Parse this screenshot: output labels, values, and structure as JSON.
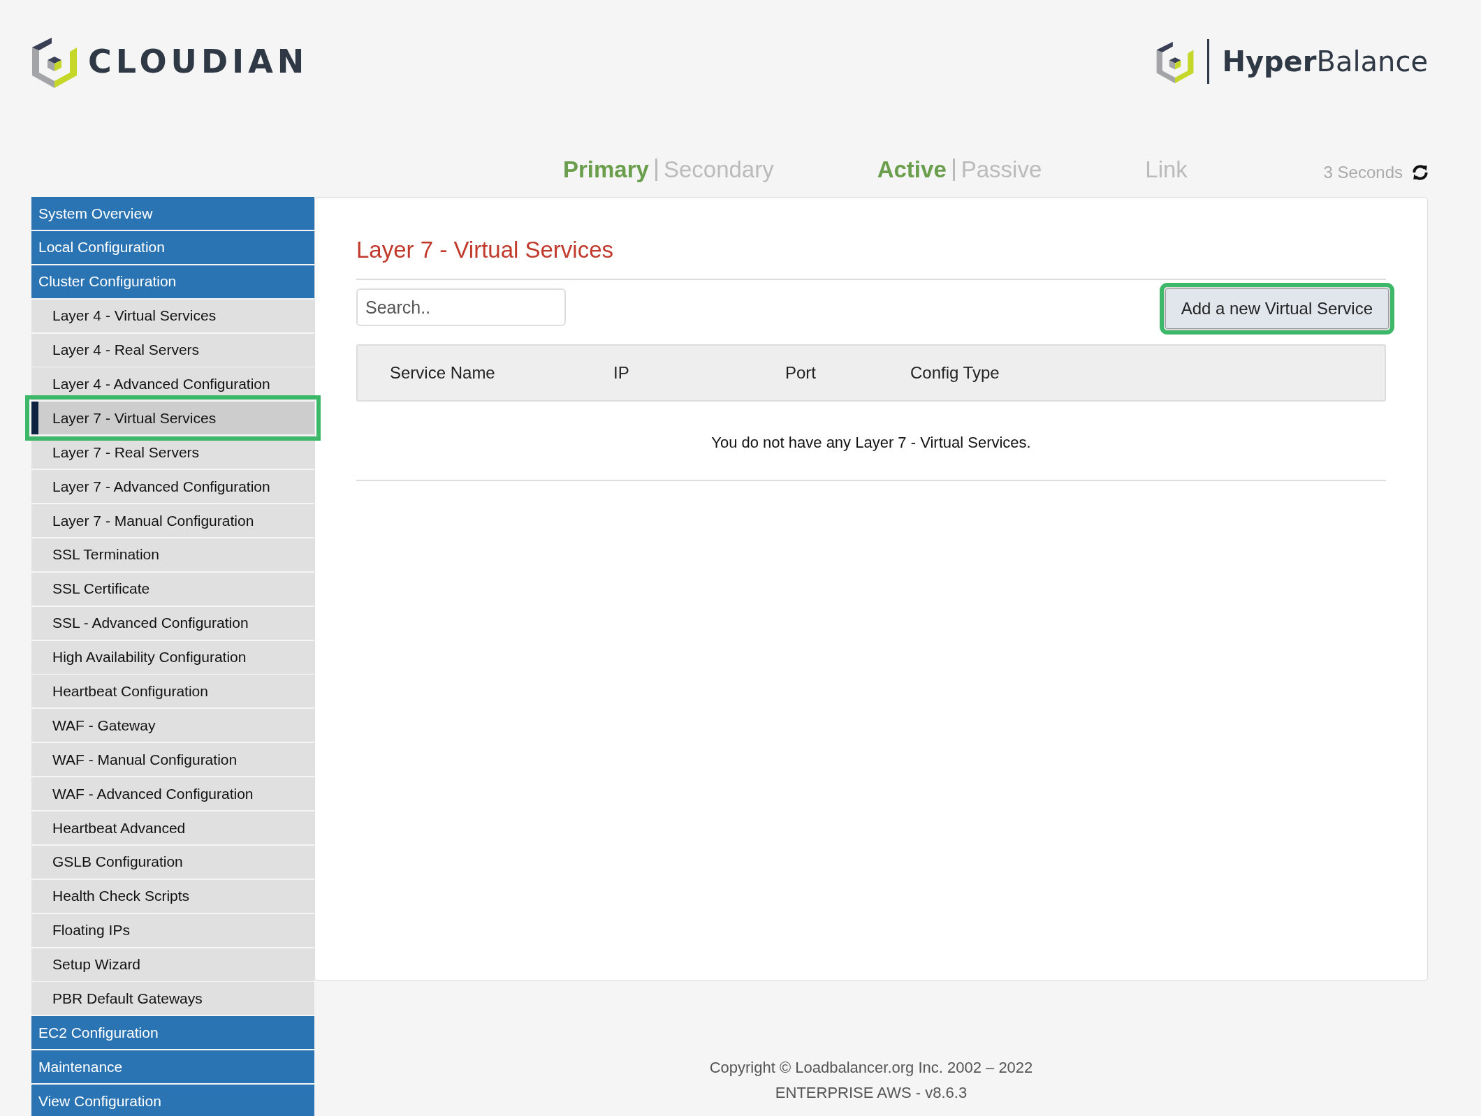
{
  "brand": {
    "left_logo": "CLOUDIAN",
    "right_logo_bold": "Hyper",
    "right_logo_light": "Balance"
  },
  "status": [
    {
      "items": [
        {
          "label": "Primary",
          "selected": true
        },
        {
          "label": "Secondary",
          "selected": false
        }
      ]
    },
    {
      "items": [
        {
          "label": "Active",
          "selected": true
        },
        {
          "label": "Passive",
          "selected": false
        }
      ]
    },
    {
      "items": [
        {
          "label": "Link",
          "selected": false
        }
      ]
    }
  ],
  "refresh": {
    "label": "3 Seconds"
  },
  "sidebar": {
    "items": [
      {
        "label": "System Overview",
        "kind": "section",
        "selected": false,
        "highlighted": false
      },
      {
        "label": "Local Configuration",
        "kind": "section",
        "selected": false,
        "highlighted": false
      },
      {
        "label": "Cluster Configuration",
        "kind": "section",
        "selected": false,
        "highlighted": false
      },
      {
        "label": "Layer 4 - Virtual Services",
        "kind": "sub",
        "selected": false,
        "highlighted": false
      },
      {
        "label": "Layer 4 - Real Servers",
        "kind": "sub",
        "selected": false,
        "highlighted": false
      },
      {
        "label": "Layer 4 - Advanced Configuration",
        "kind": "sub",
        "selected": false,
        "highlighted": false
      },
      {
        "label": "Layer 7 - Virtual Services",
        "kind": "sub",
        "selected": true,
        "highlighted": true
      },
      {
        "label": "Layer 7 - Real Servers",
        "kind": "sub",
        "selected": false,
        "highlighted": false
      },
      {
        "label": "Layer 7 - Advanced Configuration",
        "kind": "sub",
        "selected": false,
        "highlighted": false
      },
      {
        "label": "Layer 7 - Manual Configuration",
        "kind": "sub",
        "selected": false,
        "highlighted": false
      },
      {
        "label": "SSL Termination",
        "kind": "sub",
        "selected": false,
        "highlighted": false
      },
      {
        "label": "SSL Certificate",
        "kind": "sub",
        "selected": false,
        "highlighted": false
      },
      {
        "label": "SSL - Advanced Configuration",
        "kind": "sub",
        "selected": false,
        "highlighted": false
      },
      {
        "label": "High Availability Configuration",
        "kind": "sub",
        "selected": false,
        "highlighted": false
      },
      {
        "label": "Heartbeat Configuration",
        "kind": "sub",
        "selected": false,
        "highlighted": false
      },
      {
        "label": "WAF - Gateway",
        "kind": "sub",
        "selected": false,
        "highlighted": false
      },
      {
        "label": "WAF - Manual Configuration",
        "kind": "sub",
        "selected": false,
        "highlighted": false
      },
      {
        "label": "WAF - Advanced Configuration",
        "kind": "sub",
        "selected": false,
        "highlighted": false
      },
      {
        "label": "Heartbeat Advanced",
        "kind": "sub",
        "selected": false,
        "highlighted": false
      },
      {
        "label": "GSLB Configuration",
        "kind": "sub",
        "selected": false,
        "highlighted": false
      },
      {
        "label": "Health Check Scripts",
        "kind": "sub",
        "selected": false,
        "highlighted": false
      },
      {
        "label": "Floating IPs",
        "kind": "sub",
        "selected": false,
        "highlighted": false
      },
      {
        "label": "Setup Wizard",
        "kind": "sub",
        "selected": false,
        "highlighted": false
      },
      {
        "label": "PBR Default Gateways",
        "kind": "sub",
        "selected": false,
        "highlighted": false
      },
      {
        "label": "EC2 Configuration",
        "kind": "section",
        "selected": false,
        "highlighted": false
      },
      {
        "label": "Maintenance",
        "kind": "section",
        "selected": false,
        "highlighted": false
      },
      {
        "label": "View Configuration",
        "kind": "section",
        "selected": false,
        "highlighted": false
      }
    ]
  },
  "content": {
    "title": "Layer 7 - Virtual Services",
    "search": {
      "placeholder": "Search.."
    },
    "add_button": {
      "label": "Add a new Virtual Service",
      "highlighted": true
    },
    "table": {
      "columns": [
        "Service Name",
        "IP",
        "Port",
        "Config Type"
      ],
      "empty_message": "You do not have any Layer 7 - Virtual Services."
    }
  },
  "footer": {
    "copyright": "Copyright © Loadbalancer.org Inc. 2002 – 2022",
    "version": "ENTERPRISE AWS - v8.6.3"
  }
}
